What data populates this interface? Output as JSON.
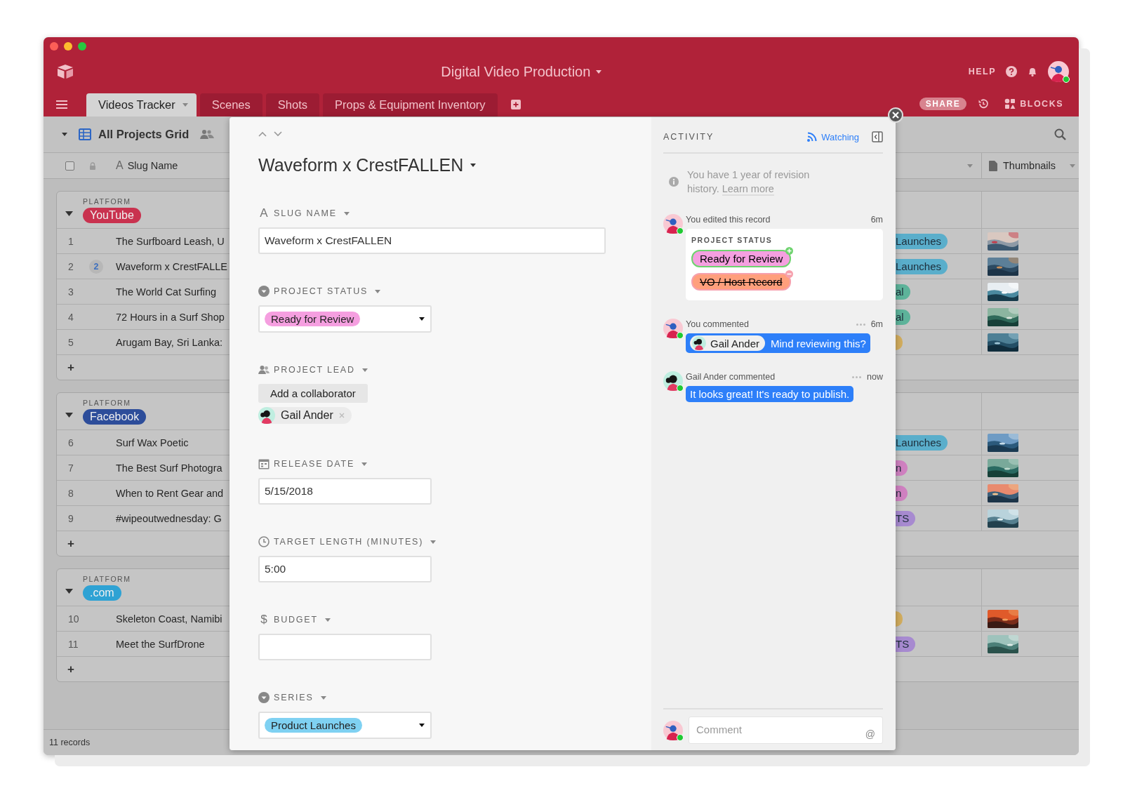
{
  "window": {
    "title": "Digital Video Production"
  },
  "header": {
    "help": "HELP",
    "share": "SHARE",
    "blocks": "BLOCKS",
    "user_avatar": {
      "kind": "self",
      "online": true
    }
  },
  "tabs": [
    {
      "label": "Videos Tracker",
      "selected": true
    },
    {
      "label": "Scenes",
      "selected": false
    },
    {
      "label": "Shots",
      "selected": false
    },
    {
      "label": "Props & Equipment Inventory",
      "selected": false
    }
  ],
  "toolbar": {
    "view_name": "All Projects Grid"
  },
  "grid": {
    "select_all": {
      "checked": false
    },
    "columns": [
      {
        "kind": "text",
        "icon": "A",
        "label": "Slug Name"
      },
      {
        "kind": "attachment",
        "label": "Thumbnails"
      }
    ],
    "groups": [
      {
        "field_label": "PLATFORM",
        "value": "YouTube",
        "color": "#c9324f",
        "add_label": "+",
        "rows": [
          {
            "number": "1",
            "slug": "The Surfboard Leash, U",
            "series": {
              "text": "Launches",
              "color": "#5aaecb"
            }
          },
          {
            "number": "2",
            "comments": "2",
            "slug": "Waveform x CrestFALLE",
            "series": {
              "text": "Launches",
              "color": "#5aaecb"
            }
          },
          {
            "number": "3",
            "slug": "The World Cat Surfing",
            "series": {
              "text": "al",
              "color": "#5db39a"
            }
          },
          {
            "number": "4",
            "slug": "72 Hours in a Surf Shop",
            "series": {
              "text": "al",
              "color": "#5db39a"
            }
          },
          {
            "number": "5",
            "slug": "Arugam Bay, Sri Lanka:",
            "series": {
              "color": "#d2ad5e"
            }
          }
        ]
      },
      {
        "field_label": "PLATFORM",
        "value": "Facebook",
        "color": "#2d4d9a",
        "add_label": "+",
        "rows": [
          {
            "number": "6",
            "slug": "Surf Wax Poetic",
            "series": {
              "text": "Launches",
              "color": "#5aaecb"
            }
          },
          {
            "number": "7",
            "slug": "The Best Surf Photogra",
            "series": {
              "text": "n",
              "color": "#cf80c0"
            }
          },
          {
            "number": "8",
            "slug": "When to Rent Gear and",
            "series": {
              "text": "n",
              "color": "#cf80c0"
            }
          },
          {
            "number": "9",
            "slug": "#wipeoutwednesday: G",
            "series": {
              "text": "TS",
              "color": "#a78ad0"
            }
          }
        ]
      },
      {
        "field_label": "PLATFORM",
        "value": ".com",
        "color": "#2ea2d4",
        "add_label": "+",
        "rows": [
          {
            "number": "10",
            "slug": "Skeleton Coast, Namibi",
            "series": {
              "color": "#d2ad5e"
            }
          },
          {
            "number": "11",
            "slug": "Meet the SurfDrone",
            "series": {
              "text": "TS",
              "color": "#a78ad0"
            }
          }
        ]
      }
    ],
    "record_count": "11 records"
  },
  "record": {
    "title": "Waveform x CrestFALLEN",
    "fields": [
      {
        "kind": "text",
        "icon": "A",
        "label": "SLUG NAME",
        "value": "Waveform x CrestFALLEN"
      },
      {
        "kind": "select",
        "label": "PROJECT STATUS",
        "value": "Ready for Review",
        "color": "#f59fe0"
      },
      {
        "kind": "collaborator",
        "label": "PROJECT LEAD",
        "button": "Add a collaborator",
        "people": [
          {
            "name": "Gail Ander",
            "avatar": {
              "kind": "other"
            }
          }
        ]
      },
      {
        "kind": "date",
        "label": "RELEASE DATE",
        "value": "5/15/2018"
      },
      {
        "kind": "duration",
        "label": "TARGET LENGTH (MINUTES)",
        "value": "5:00"
      },
      {
        "kind": "currency",
        "icon": "$",
        "label": "BUDGET"
      },
      {
        "kind": "select",
        "label": "SERIES",
        "value": "Product Launches",
        "color": "#7fd1f2"
      }
    ]
  },
  "activity": {
    "title": "ACTIVITY",
    "watching": "Watching",
    "notice": "You have 1 year of revision history.",
    "notice_link": "Learn more",
    "events": [
      {
        "kind": "edit",
        "actor": "You edited this record",
        "time": "6m",
        "avatar": {
          "kind": "self",
          "online": true
        },
        "field": "PROJECT STATUS",
        "added": {
          "text": "Ready for Review",
          "color": "#f59fe0"
        },
        "removed": {
          "text": "VO / Host Record",
          "color": "#ff9f7c"
        }
      },
      {
        "kind": "comment",
        "actor": "You commented",
        "time": "6m",
        "avatar": {
          "kind": "self",
          "online": true
        },
        "mention": {
          "name": "Gail Ander",
          "avatar": {
            "kind": "other"
          }
        },
        "text": "Mind reviewing this?"
      },
      {
        "kind": "comment",
        "actor": "Gail Ander commented",
        "time": "now",
        "avatar": {
          "kind": "other",
          "online": true
        },
        "text": "It looks great! It's ready to publish."
      }
    ],
    "composer": {
      "placeholder": "Comment",
      "mention_key": "@",
      "avatar": {
        "kind": "self",
        "online": true
      }
    }
  }
}
